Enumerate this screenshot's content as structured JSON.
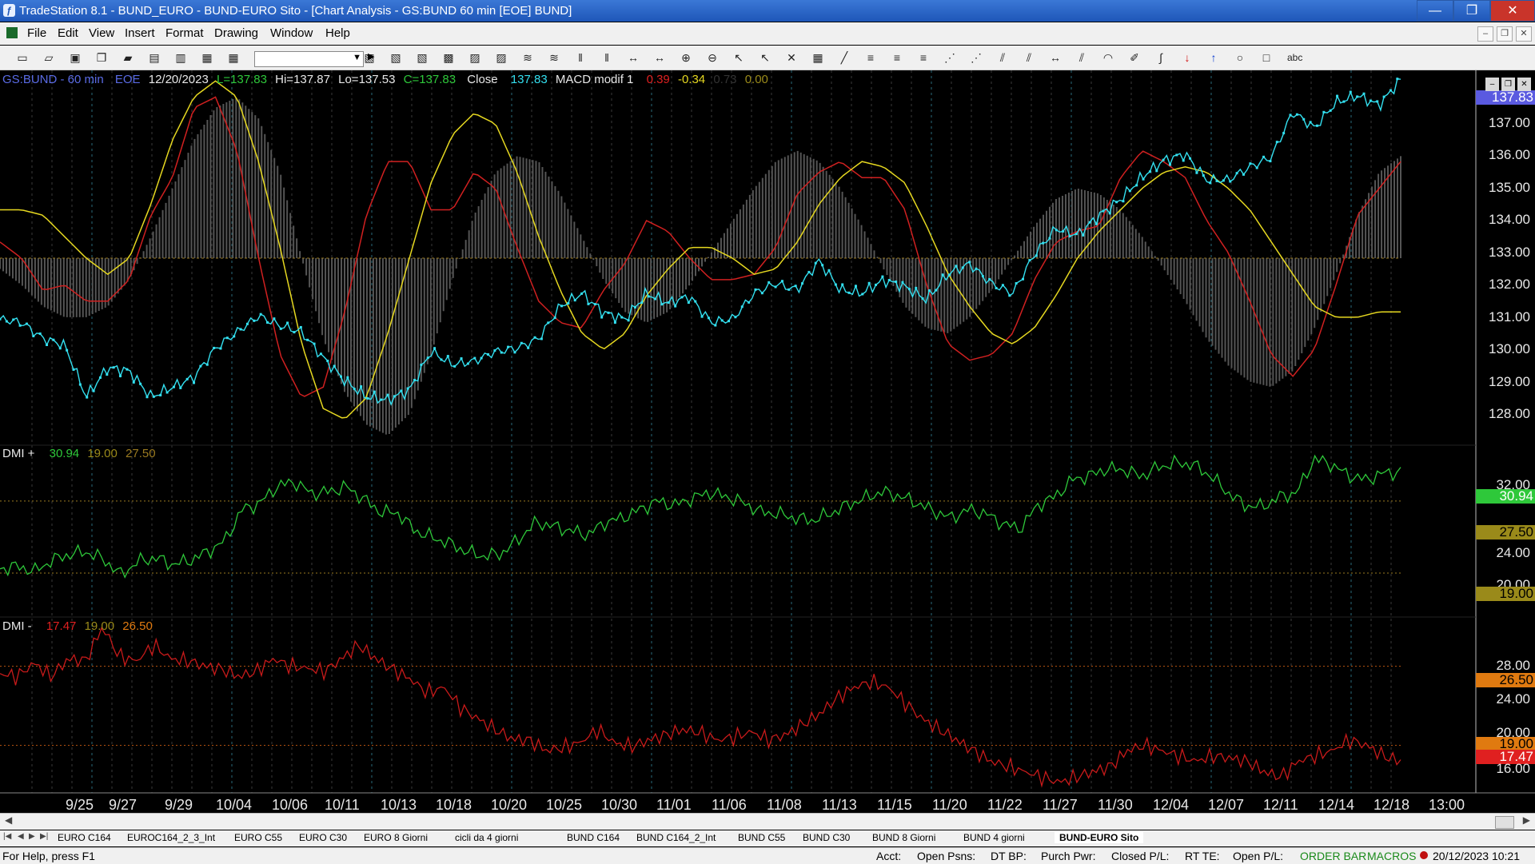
{
  "window": {
    "title": "TradeStation 8.1 - BUND_EURO - BUND-EURO Sito - [Chart Analysis - GS:BUND  60 min  [EOE] BUND]",
    "buttons": [
      "—",
      "❐",
      "✕"
    ]
  },
  "menu": [
    "File",
    "Edit",
    "View",
    "Insert",
    "Format",
    "Drawing",
    "Window",
    "Help"
  ],
  "mdi_buttons": [
    "–",
    "❐",
    "✕"
  ],
  "toolbar": {
    "icons": [
      "new-icon",
      "open-icon",
      "save-icon",
      "copy-icon",
      "folder-icon",
      "print-icon",
      "print-preview-icon",
      "window-icon",
      "window-icon",
      "lock-icon",
      "drawing-icon",
      "colors-icon",
      "chart-icon",
      "chart-icon",
      "chart-icon",
      "grid-icon",
      "insert-icon",
      "insert-icon",
      "analysis-icon",
      "analysis-icon",
      "bar-icon",
      "bar-icon",
      "scale-icon",
      "scale-icon",
      "zoom-in-icon",
      "zoom-out-icon",
      "pointer-icon",
      "pointer-icon",
      "tool-icon",
      "window-icon",
      "trendline-icon",
      "lines-icon",
      "lines-icon",
      "lines-icon",
      "fib-icon",
      "fib-icon",
      "channel-icon",
      "channel-icon",
      "arrow-icon",
      "channel-icon",
      "arc-icon",
      "pencil-icon",
      "curve-icon",
      "arrow-down-icon",
      "arrow-up-icon",
      "circle-icon",
      "rect-icon",
      "text-icon"
    ],
    "combo_value": "",
    "text_tool_label": "abc"
  },
  "header": {
    "symbol": "GS:BUND - 60 min",
    "feed": "EOE",
    "date": "12/20/2023",
    "last": "L=137.83",
    "high": "Hi=137.87",
    "low": "Lo=137.53",
    "close_val": "C=137.83",
    "close_label": "Close",
    "close_value": "137.83",
    "macd_label": "MACD modif 1",
    "macd_v1": "0.39",
    "macd_v2": "-0.34",
    "macd_v3": "0.73",
    "macd_v4": "0.00"
  },
  "dmi_plus": {
    "label": "DMI +",
    "v1": "30.94",
    "v2": "19.00",
    "v3": "27.50"
  },
  "dmi_minus": {
    "label": "DMI -",
    "v1": "17.47",
    "v2": "19.00",
    "v3": "26.50"
  },
  "price_axis": {
    "labels": [
      "137.00",
      "136.00",
      "135.00",
      "134.00",
      "133.00",
      "132.00",
      "131.00",
      "130.00",
      "129.00",
      "128.00"
    ],
    "current": "137.83"
  },
  "dmi_plus_axis": {
    "labels": [
      "32.00",
      "24.00",
      "20.00"
    ],
    "tags": [
      "30.94",
      "27.50",
      "19.00"
    ]
  },
  "dmi_minus_axis": {
    "labels": [
      "28.00",
      "24.00",
      "20.00",
      "16.00"
    ],
    "tags": [
      "26.50",
      "19.00",
      "17.47"
    ]
  },
  "colors": {
    "price": "#33e0f0",
    "macd_fast": "#d02020",
    "macd_slow": "#e6d820",
    "histogram": "#555555",
    "dmi_plus": "#2ec83a",
    "dmi_minus": "#c81a1a",
    "level_line": "#9a7a20",
    "axis_text": "#e8e8e8",
    "tag_green": "#2ec83a",
    "tag_olive": "#9a8a1a",
    "tag_orange": "#e07a10",
    "tag_red": "#e02020",
    "tag_blue": "#5a5ae0"
  },
  "x_axis": [
    "9/25",
    "9/27",
    "9/29",
    "10/04",
    "10/06",
    "10/11",
    "10/13",
    "10/18",
    "10/20",
    "10/25",
    "10/30",
    "11/01",
    "11/06",
    "11/08",
    "11/13",
    "11/15",
    "11/20",
    "11/22",
    "11/27",
    "11/30",
    "12/04",
    "12/07",
    "12/11",
    "12/14",
    "12/18",
    "13:00"
  ],
  "tabs": [
    "EURO C164",
    "EUROC164_2_3_Int",
    "EURO C55",
    "EURO C30",
    "EURO 8 Giorni",
    "cicli da 4 giorni",
    "BUND C164",
    "BUND C164_2_Int",
    "BUND C55",
    "BUND  C30",
    "BUND 8 Giorni",
    "BUND 4 giorni",
    "BUND-EURO Sito"
  ],
  "active_tab": "BUND-EURO Sito",
  "status": {
    "help": "For Help, press F1",
    "acct": "Acct:",
    "open_psns": "Open Psns:",
    "dt_bp": "DT BP:",
    "purch_pwr": "Purch Pwr:",
    "closed_pl": "Closed P/L:",
    "rt_te": "RT TE:",
    "open_pl": "Open P/L:",
    "order_bar": "ORDER BAR",
    "macros": "MACROS",
    "datetime": "20/12/2023 10:21"
  },
  "chart_data": {
    "type": "line",
    "x_labels": [
      "9/25",
      "9/27",
      "9/29",
      "10/04",
      "10/06",
      "10/11",
      "10/13",
      "10/18",
      "10/20",
      "10/25",
      "10/30",
      "11/01",
      "11/06",
      "11/08",
      "11/13",
      "11/15",
      "11/20",
      "11/22",
      "11/27",
      "11/30",
      "12/04",
      "12/07",
      "12/11",
      "12/14",
      "12/18"
    ],
    "panels": [
      {
        "name": "price",
        "ylim": [
          127.3,
          138.2
        ],
        "series": [
          {
            "name": "Close",
            "values": [
              130.4,
              130.3,
              129.8,
              129.6,
              128.0,
              128.9,
              128.8,
              128.0,
              128.3,
              128.6,
              129.5,
              130.0,
              130.5,
              130.2,
              130.0,
              129.2,
              128.5,
              128.0,
              127.9,
              128.2,
              129.4,
              129.0,
              129.1,
              129.4,
              129.5,
              129.8,
              130.8,
              131.2,
              130.6,
              130.4,
              131.2,
              130.9,
              131.1,
              130.3,
              130.4,
              131.2,
              131.5,
              131.3,
              132.2,
              131.3,
              131.2,
              131.6,
              131.4,
              131.0,
              131.8,
              132.1,
              131.5,
              131.2,
              132.4,
              133.2,
              133.0,
              133.6,
              134.1,
              134.8,
              135.3,
              135.5,
              134.7,
              134.7,
              135.1,
              135.4,
              136.8,
              136.3,
              137.1,
              137.3,
              137.0,
              137.8
            ]
          }
        ]
      },
      {
        "name": "MACD",
        "ylim": [
          -3.2,
          3.2
        ],
        "series": [
          {
            "name": "MACD modif 1",
            "values": [
              0.3,
              0.0,
              -0.6,
              -0.5,
              -0.8,
              -0.8,
              -0.4,
              0.8,
              1.5,
              2.8,
              3.0,
              2.0,
              0.0,
              -1.8,
              -2.6,
              -2.4,
              -1.0,
              0.8,
              1.8,
              1.8,
              0.9,
              0.9,
              1.6,
              1.3,
              0.2,
              -0.8,
              -1.2,
              -1.3,
              -0.6,
              -0.1,
              0.7,
              0.5,
              0.0,
              -0.4,
              -0.4,
              -0.3,
              0.2,
              1.2,
              1.6,
              1.8,
              1.5,
              1.5,
              0.9,
              -0.5,
              -1.6,
              -1.9,
              -1.8,
              -1.4,
              -0.4,
              0.3,
              0.5,
              0.6,
              1.5,
              2.0,
              1.8,
              1.5,
              0.7,
              0.1,
              -0.8,
              -1.8,
              -2.2,
              -1.7,
              -0.5,
              0.8,
              1.3,
              1.8
            ]
          },
          {
            "name": "Avg",
            "values": [
              0.9,
              0.9,
              0.8,
              0.4,
              0.0,
              -0.3,
              0.0,
              1.0,
              2.2,
              3.0,
              3.3,
              3.0,
              1.8,
              0.2,
              -1.6,
              -2.8,
              -3.0,
              -2.6,
              -1.4,
              0.0,
              1.4,
              2.3,
              2.7,
              2.5,
              1.6,
              0.4,
              -0.6,
              -1.4,
              -1.7,
              -1.4,
              -0.7,
              -0.2,
              0.2,
              0.2,
              0.0,
              -0.3,
              -0.2,
              0.3,
              1.0,
              1.5,
              1.8,
              1.7,
              1.4,
              0.6,
              -0.3,
              -0.9,
              -1.4,
              -1.6,
              -1.3,
              -0.7,
              0.0,
              0.5,
              0.9,
              1.3,
              1.6,
              1.7,
              1.6,
              1.3,
              0.9,
              0.3,
              -0.3,
              -0.9,
              -1.1,
              -1.1,
              -1.0,
              -1.0
            ]
          },
          {
            "name": "Hist",
            "values": [
              -0.2,
              -0.5,
              -0.9,
              -1.1,
              -1.1,
              -0.9,
              -0.4,
              0.4,
              1.3,
              2.2,
              2.8,
              3.0,
              2.6,
              1.6,
              0.0,
              -1.5,
              -2.5,
              -3.1,
              -3.3,
              -2.9,
              -1.8,
              -0.4,
              0.8,
              1.6,
              1.9,
              1.8,
              1.2,
              0.4,
              -0.4,
              -1.0,
              -1.2,
              -1.0,
              -0.5,
              0.1,
              0.7,
              1.3,
              1.8,
              2.0,
              1.8,
              1.3,
              0.6,
              -0.2,
              -0.9,
              -1.3,
              -1.4,
              -1.1,
              -0.6,
              0.0,
              0.6,
              1.1,
              1.3,
              1.2,
              0.9,
              0.4,
              -0.2,
              -0.8,
              -1.5,
              -2.0,
              -2.3,
              -2.4,
              -2.1,
              -1.3,
              -0.3,
              0.8,
              1.6,
              1.9
            ]
          }
        ]
      },
      {
        "name": "DMI +",
        "ylim": [
          14,
          34
        ],
        "levels": [
          27.5,
          19.0
        ],
        "series": [
          {
            "name": "DMI +",
            "values": [
              19.5,
              19.8,
              19.2,
              20.5,
              21.2,
              21.5,
              20.6,
              18.8,
              20.4,
              20.8,
              20.0,
              20.5,
              21.5,
              22.8,
              26.5,
              27.2,
              29.2,
              29.8,
              28.4,
              28.6,
              29.2,
              27.8,
              26.2,
              26.1,
              24.0,
              23.2,
              22.5,
              21.5,
              21.0,
              21.3,
              23.0,
              25.0,
              24.5,
              24.0,
              23.5,
              25.0,
              25.5,
              26.5,
              27.5,
              27.0,
              27.8,
              28.5,
              28.0,
              27.3,
              26.2,
              26.0,
              25.5,
              25.2,
              26.0,
              27.0,
              27.8,
              28.6,
              28.1,
              27.3,
              26.3,
              25.5,
              26.5,
              26.0,
              24.8,
              24.2,
              27.0,
              28.0,
              30.0,
              30.5,
              31.3,
              31.2,
              30.4,
              31.5,
              32.0,
              31.8,
              30.5,
              28.5,
              27.0,
              26.8,
              28.0,
              28.5,
              32.5,
              31.8,
              30.5,
              30.0,
              30.8,
              30.94
            ]
          }
        ]
      },
      {
        "name": "DMI -",
        "ylim": [
          14.5,
          31
        ],
        "levels": [
          26.5,
          19.0
        ],
        "series": [
          {
            "name": "DMI -",
            "values": [
              25.8,
              25.5,
              26.8,
              25.5,
              27.2,
              27.0,
              30.2,
              27.4,
              27.0,
              28.5,
              27.2,
              27.0,
              26.5,
              26.2,
              25.5,
              26.0,
              27.2,
              26.5,
              26.3,
              26.0,
              27.2,
              28.5,
              27.2,
              26.2,
              25.3,
              24.0,
              24.5,
              22.5,
              21.5,
              20.5,
              19.6,
              19.5,
              18.5,
              18.8,
              19.3,
              20.5,
              19.2,
              18.9,
              19.5,
              20.0,
              20.5,
              20.2,
              19.5,
              19.8,
              20.3,
              19.5,
              20.0,
              21.0,
              22.0,
              23.5,
              24.5,
              25.0,
              24.5,
              23.0,
              21.5,
              20.5,
              19.5,
              18.5,
              17.5,
              17.0,
              16.5,
              16.0,
              15.5,
              16.0,
              16.5,
              17.0,
              18.5,
              19.0,
              18.5,
              18.0,
              17.5,
              18.0,
              17.8,
              17.5,
              16.5,
              16.0,
              17.5,
              18.0,
              18.5,
              19.5,
              19.0,
              18.0,
              17.47
            ]
          }
        ]
      }
    ]
  }
}
